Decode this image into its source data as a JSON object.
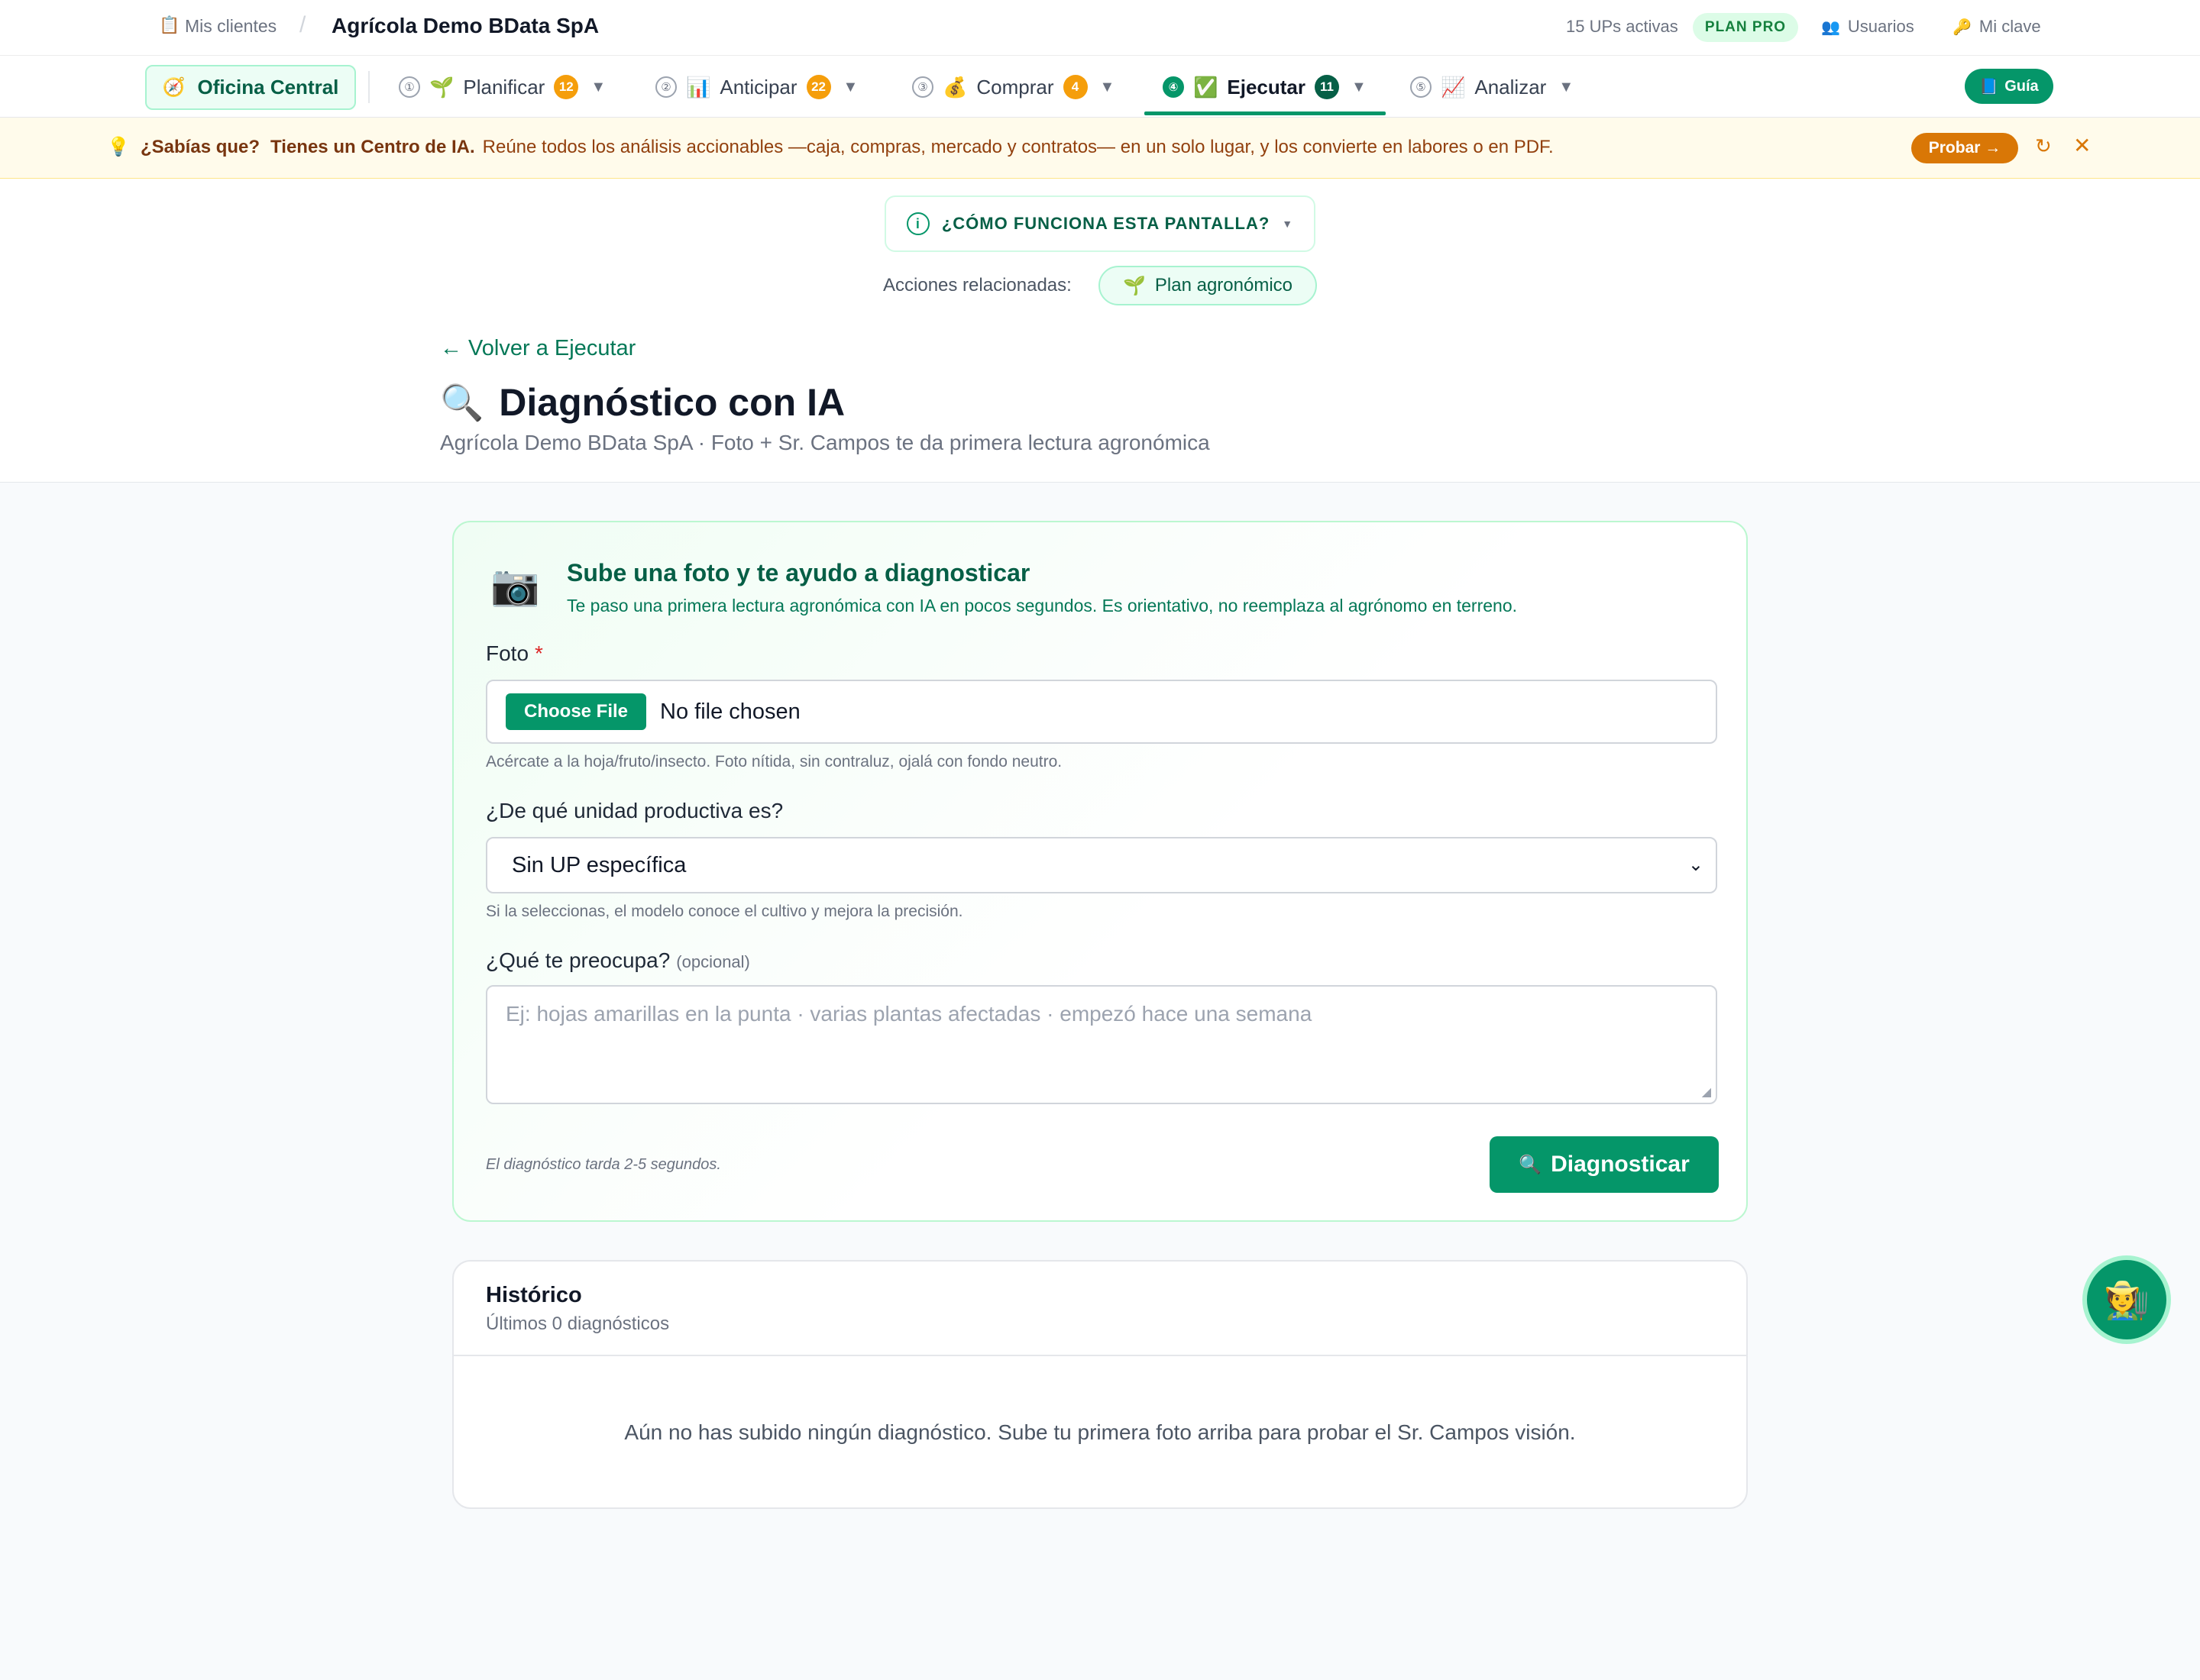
{
  "topbar": {
    "breadcrumb_icon": "clipboard-icon",
    "breadcrumb_link": "Mis clientes",
    "breadcrumb_separator": "/",
    "client_name": "Agrícola Demo BData SpA",
    "ups_active": "15 UPs activas",
    "plan_badge": "PLAN PRO",
    "users_label": "Usuarios",
    "key_label": "Mi clave"
  },
  "nav": {
    "office_label": "Oficina Central",
    "items": [
      {
        "step": "①",
        "label": "Planificar",
        "count": "12",
        "icon": "seedling-icon"
      },
      {
        "step": "②",
        "label": "Anticipar",
        "count": "22",
        "icon": "bar-chart-icon"
      },
      {
        "step": "③",
        "label": "Comprar",
        "count": "4",
        "icon": "money-bag-icon"
      },
      {
        "step": "④",
        "label": "Ejecutar",
        "count": "11",
        "icon": "check-box-icon",
        "active": true
      },
      {
        "step": "⑤",
        "label": "Analizar",
        "count": "",
        "icon": "line-chart-icon"
      }
    ],
    "guide_label": "Guía"
  },
  "tip": {
    "question": "¿Sabías que?",
    "headline": "Tienes un Centro de IA.",
    "body": "Reúne todos los análisis accionables —caja, compras, mercado y contratos— en un solo lugar, y los convierte en labores o en PDF.",
    "try_label": "Probar →"
  },
  "header": {
    "how_label": "¿CÓMO FUNCIONA ESTA PANTALLA?",
    "related_label": "Acciones relacionadas:",
    "related_pill": "Plan agronómico",
    "back_link": "← Volver a Ejecutar",
    "title": "Diagnóstico con IA",
    "subtitle": "Agrícola Demo BData SpA · Foto + Sr. Campos te da primera lectura agronómica"
  },
  "upload": {
    "heading": "Sube una foto y te ayudo a diagnosticar",
    "description": "Te paso una primera lectura agronómica con IA en pocos segundos. Es orientativo, no reemplaza al agrónomo en terreno.",
    "photo_label": "Foto",
    "required_mark": "*",
    "choose_file": "Choose File",
    "no_file": "No file chosen",
    "photo_hint": "Acércate a la hoja/fruto/insecto. Foto nítida, sin contraluz, ojalá con fondo neutro.",
    "unit_label": "¿De qué unidad productiva es?",
    "unit_selected": "Sin UP específica",
    "unit_hint": "Si la seleccionas, el modelo conoce el cultivo y mejora la precisión.",
    "concern_label": "¿Qué te preocupa?",
    "concern_optional": "(opcional)",
    "concern_placeholder": "Ej: hojas amarillas en la punta · varias plantas afectadas · empezó hace una semana",
    "time_note": "El diagnóstico tarda 2-5 segundos.",
    "diagnose_label": "Diagnosticar"
  },
  "history": {
    "title": "Histórico",
    "subtitle": "Últimos 0 diagnósticos",
    "empty_message": "Aún no has subido ningún diagnóstico. Sube tu primera foto arriba para probar el Sr. Campos visión."
  },
  "colors": {
    "brand_green": "#059669",
    "dark_green": "#065f46",
    "amber": "#d97706",
    "count_badge": "#f59e0b"
  }
}
